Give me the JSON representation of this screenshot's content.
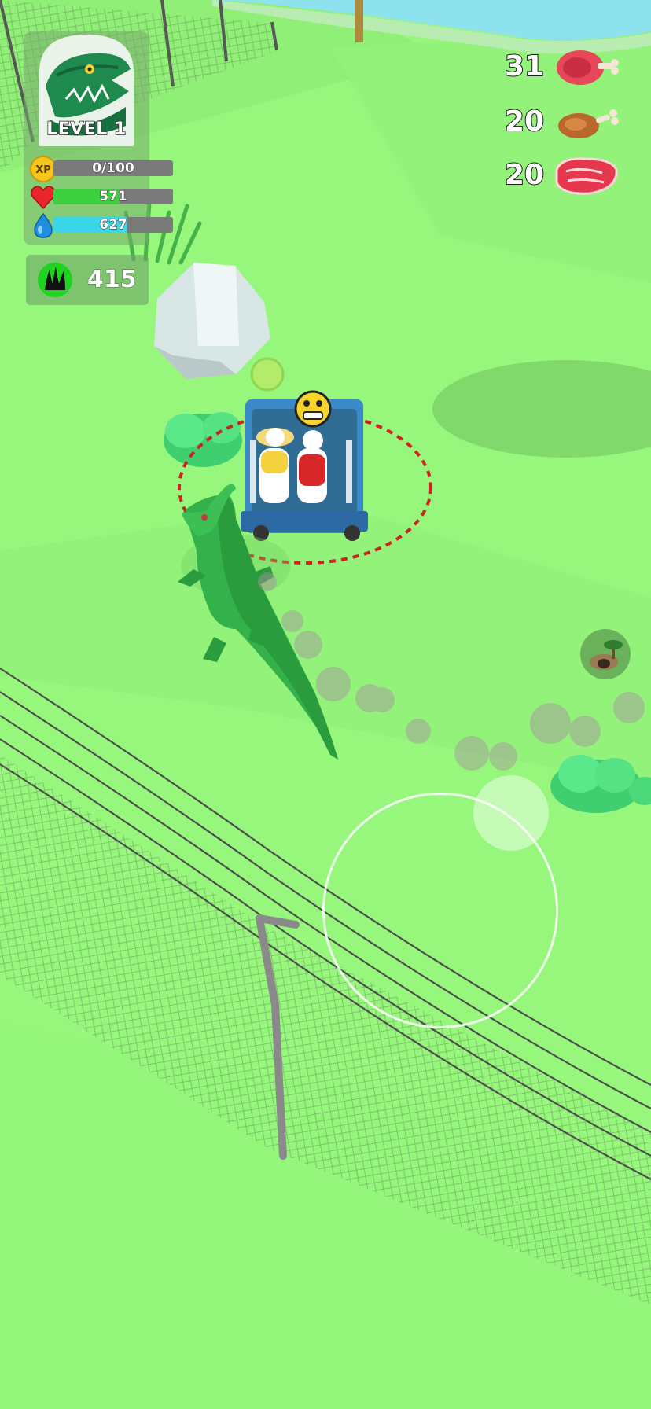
{
  "player": {
    "level_label": "LEVEL 1",
    "portrait_icon": "crocodile-head-icon"
  },
  "stats": {
    "xp": {
      "icon": "xp-coin-icon",
      "icon_text": "XP",
      "text": "0/100",
      "fill": 0.0,
      "color": "#f5c518"
    },
    "health": {
      "icon": "heart-icon",
      "text": "571",
      "fill": 0.55,
      "color": "#3ecf3e"
    },
    "water": {
      "icon": "water-drop-icon",
      "text": "627",
      "fill": 0.62,
      "color": "#38d6e8"
    }
  },
  "dna": {
    "icon": "dna-claw-icon",
    "value": "415"
  },
  "food": [
    {
      "count": "31",
      "icon": "ham-icon"
    },
    {
      "count": "20",
      "icon": "drumstick-icon"
    },
    {
      "count": "20",
      "icon": "steak-icon"
    }
  ],
  "world": {
    "ground_color": "#95f77c",
    "water_color": "#8de2ee",
    "attack_ring_color": "#d02020",
    "prey_emoji": "scared-face-icon",
    "map_marker_icon": "cave-tree-icon"
  }
}
